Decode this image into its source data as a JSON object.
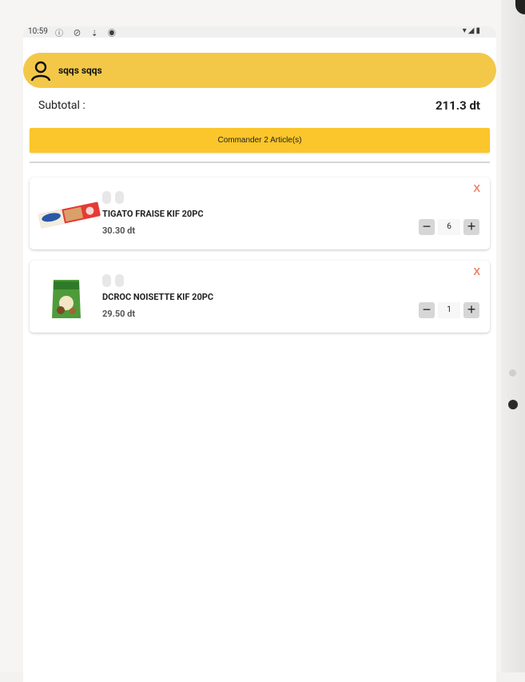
{
  "status_bar": {
    "time": "10:59",
    "left_icons": "ⓘ ⊘ ⇣ ◉",
    "right_icons": "▾◢▮"
  },
  "header": {
    "user_name": "sqqs sqqs",
    "icon": "user-icon",
    "color": "#f3c849"
  },
  "cart": {
    "subtotal_label": "Subtotal :",
    "subtotal_value": "211.3 dt",
    "order_button_label": "Commander 2 Article(s)",
    "items": [
      {
        "name": "TIGATO FRAISE KIF 20PC",
        "price": "30.30 dt",
        "quantity": "6",
        "remove_label": "X",
        "minus_label": "−",
        "plus_label": "+"
      },
      {
        "name": "DCROC NOISETTE KIF 20PC",
        "price": "29.50 dt",
        "quantity": "1",
        "remove_label": "X",
        "minus_label": "−",
        "plus_label": "+"
      }
    ]
  },
  "colors": {
    "accent": "#fbc62b",
    "remove": "#f08366"
  }
}
